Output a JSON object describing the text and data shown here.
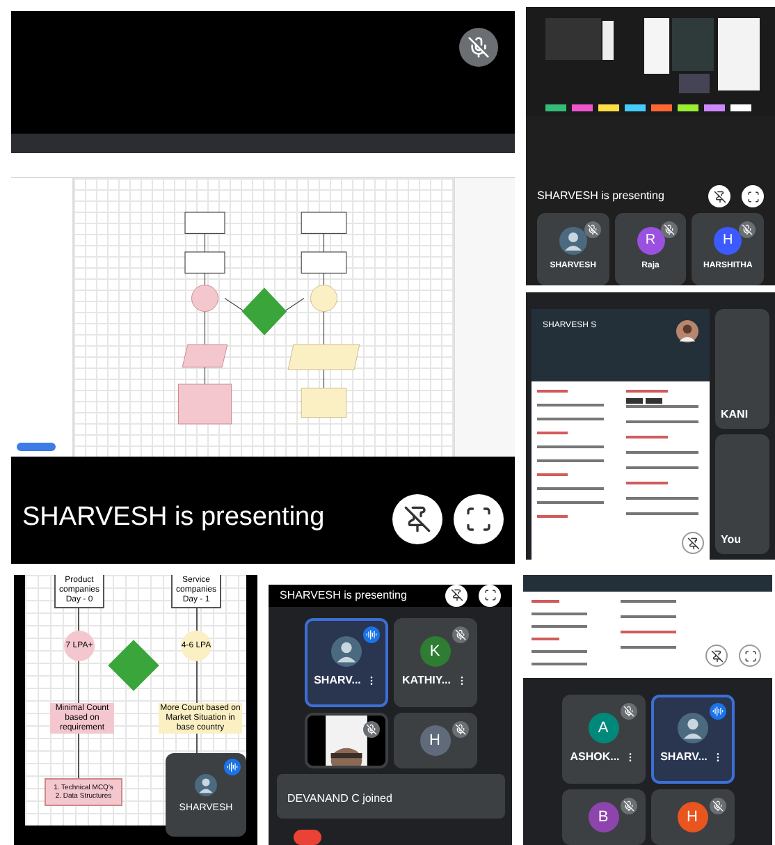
{
  "main_share": {
    "caption": "SHARVESH is presenting",
    "mic_muted": true
  },
  "top_right": {
    "caption": "SHARVESH is presenting",
    "participants": [
      {
        "name": "SHARVESH",
        "speaking": false
      },
      {
        "kind": "initial",
        "initial": "R",
        "name": "Raja",
        "color": "#9b51e0",
        "speaking": false
      },
      {
        "kind": "initial",
        "initial": "H",
        "name": "HARSHITHA",
        "color": "#3d5afe",
        "speaking": false
      }
    ]
  },
  "resume_share": {
    "name": "SHARVESH S",
    "side_tiles": [
      {
        "name": "KANI"
      },
      {
        "name": "You"
      }
    ]
  },
  "flow_zoom": {
    "top_boxes": [
      "Product companies Day - 0",
      "Service companies Day - 1"
    ],
    "circles": [
      "7 LPA+",
      "4-6 LPA"
    ],
    "counts": [
      "Minimal Count based on requirement",
      "More Count based on Market Situation in base country"
    ],
    "rounds": [
      "1. Technical MCQ's",
      "2. Data Structures"
    ],
    "self_tile": {
      "name": "SHARVESH"
    }
  },
  "phone_left": {
    "caption": "SHARVESH is presenting",
    "participants": [
      {
        "name": "SHARV...",
        "speaking": true
      },
      {
        "kind": "initial",
        "initial": "K",
        "name": "KATHIY...",
        "color": "#2e7d32",
        "speaking": false
      },
      {
        "kind": "video",
        "speaking": false
      },
      {
        "kind": "initial",
        "initial": "H",
        "color": "#5f6b7a",
        "speaking": false
      }
    ],
    "toast": "DEVANAND C joined"
  },
  "phone_right": {
    "participants": [
      {
        "kind": "initial",
        "initial": "A",
        "name": "ASHOK...",
        "color": "#00897b",
        "speaking": false
      },
      {
        "name": "SHARV...",
        "speaking": true
      },
      {
        "kind": "initial",
        "initial": "B",
        "color": "#8e44ad",
        "speaking": false
      },
      {
        "kind": "initial",
        "initial": "H",
        "color": "#e8551f",
        "speaking": false
      }
    ]
  }
}
